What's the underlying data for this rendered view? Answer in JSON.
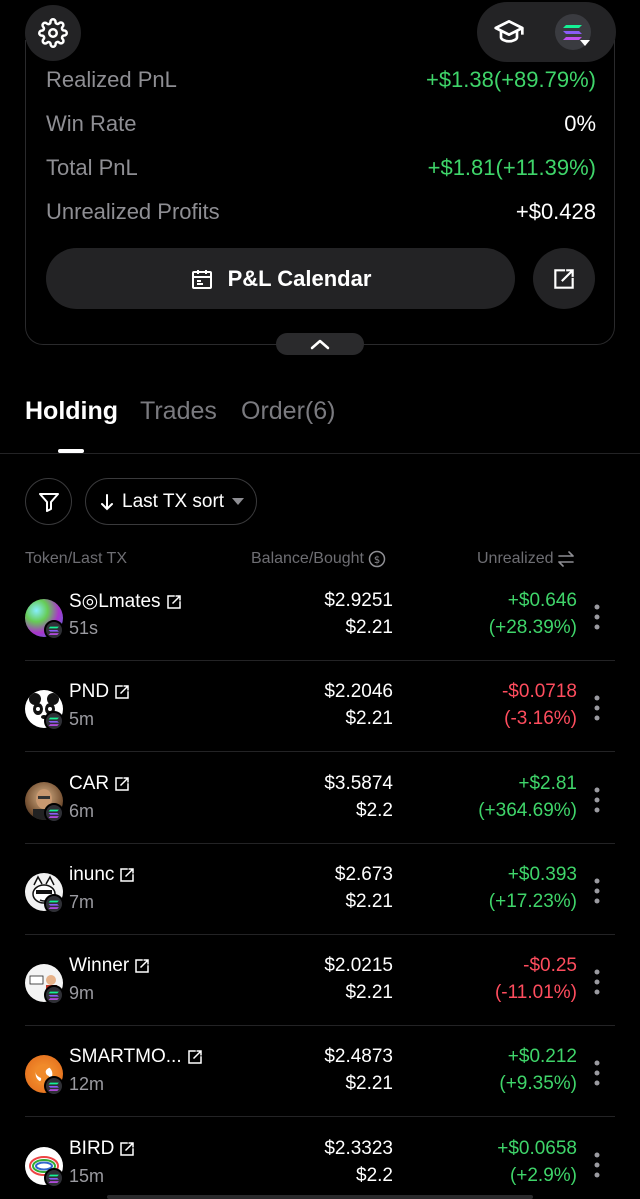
{
  "stats": {
    "realized": {
      "label": "Realized PnL",
      "value": "+$1.38(+89.79%)"
    },
    "winrate": {
      "label": "Win Rate",
      "value": "0%"
    },
    "total": {
      "label": "Total PnL",
      "value": "+$1.81(+11.39%)"
    },
    "unrealized": {
      "label": "Unrealized Profits",
      "value": "+$0.428"
    },
    "calendar_label": "P&L Calendar"
  },
  "tabs": {
    "holding": "Holding",
    "trades": "Trades",
    "order": "Order(6)"
  },
  "filters": {
    "sort_label": "Last TX sort"
  },
  "columns": {
    "token": "Token/Last TX",
    "balance": "Balance/Bought",
    "unrealized": "Unrealized"
  },
  "colors": {
    "profit": "#3fd56a",
    "loss": "#ff4d5e"
  },
  "rows": [
    {
      "name": "S◎Lmates",
      "time": "51s",
      "balance": "$2.9251",
      "bought": "$2.21",
      "unrealized": "+$0.646",
      "pct": "(+28.39%)",
      "status": "profit"
    },
    {
      "name": "PND",
      "time": "5m",
      "balance": "$2.2046",
      "bought": "$2.21",
      "unrealized": "-$0.0718",
      "pct": "(-3.16%)",
      "status": "loss"
    },
    {
      "name": "CAR",
      "time": "6m",
      "balance": "$3.5874",
      "bought": "$2.2",
      "unrealized": "+$2.81",
      "pct": "(+364.69%)",
      "status": "profit"
    },
    {
      "name": "inunc",
      "time": "7m",
      "balance": "$2.673",
      "bought": "$2.21",
      "unrealized": "+$0.393",
      "pct": "(+17.23%)",
      "status": "profit"
    },
    {
      "name": "Winner",
      "time": "9m",
      "balance": "$2.0215",
      "bought": "$2.21",
      "unrealized": "-$0.25",
      "pct": "(-11.01%)",
      "status": "loss"
    },
    {
      "name": "SMARTMO...",
      "time": "12m",
      "balance": "$2.4873",
      "bought": "$2.21",
      "unrealized": "+$0.212",
      "pct": "(+9.35%)",
      "status": "profit"
    },
    {
      "name": "BIRD",
      "time": "15m",
      "balance": "$2.3323",
      "bought": "$2.2",
      "unrealized": "+$0.0658",
      "pct": "(+2.9%)",
      "status": "profit"
    }
  ]
}
